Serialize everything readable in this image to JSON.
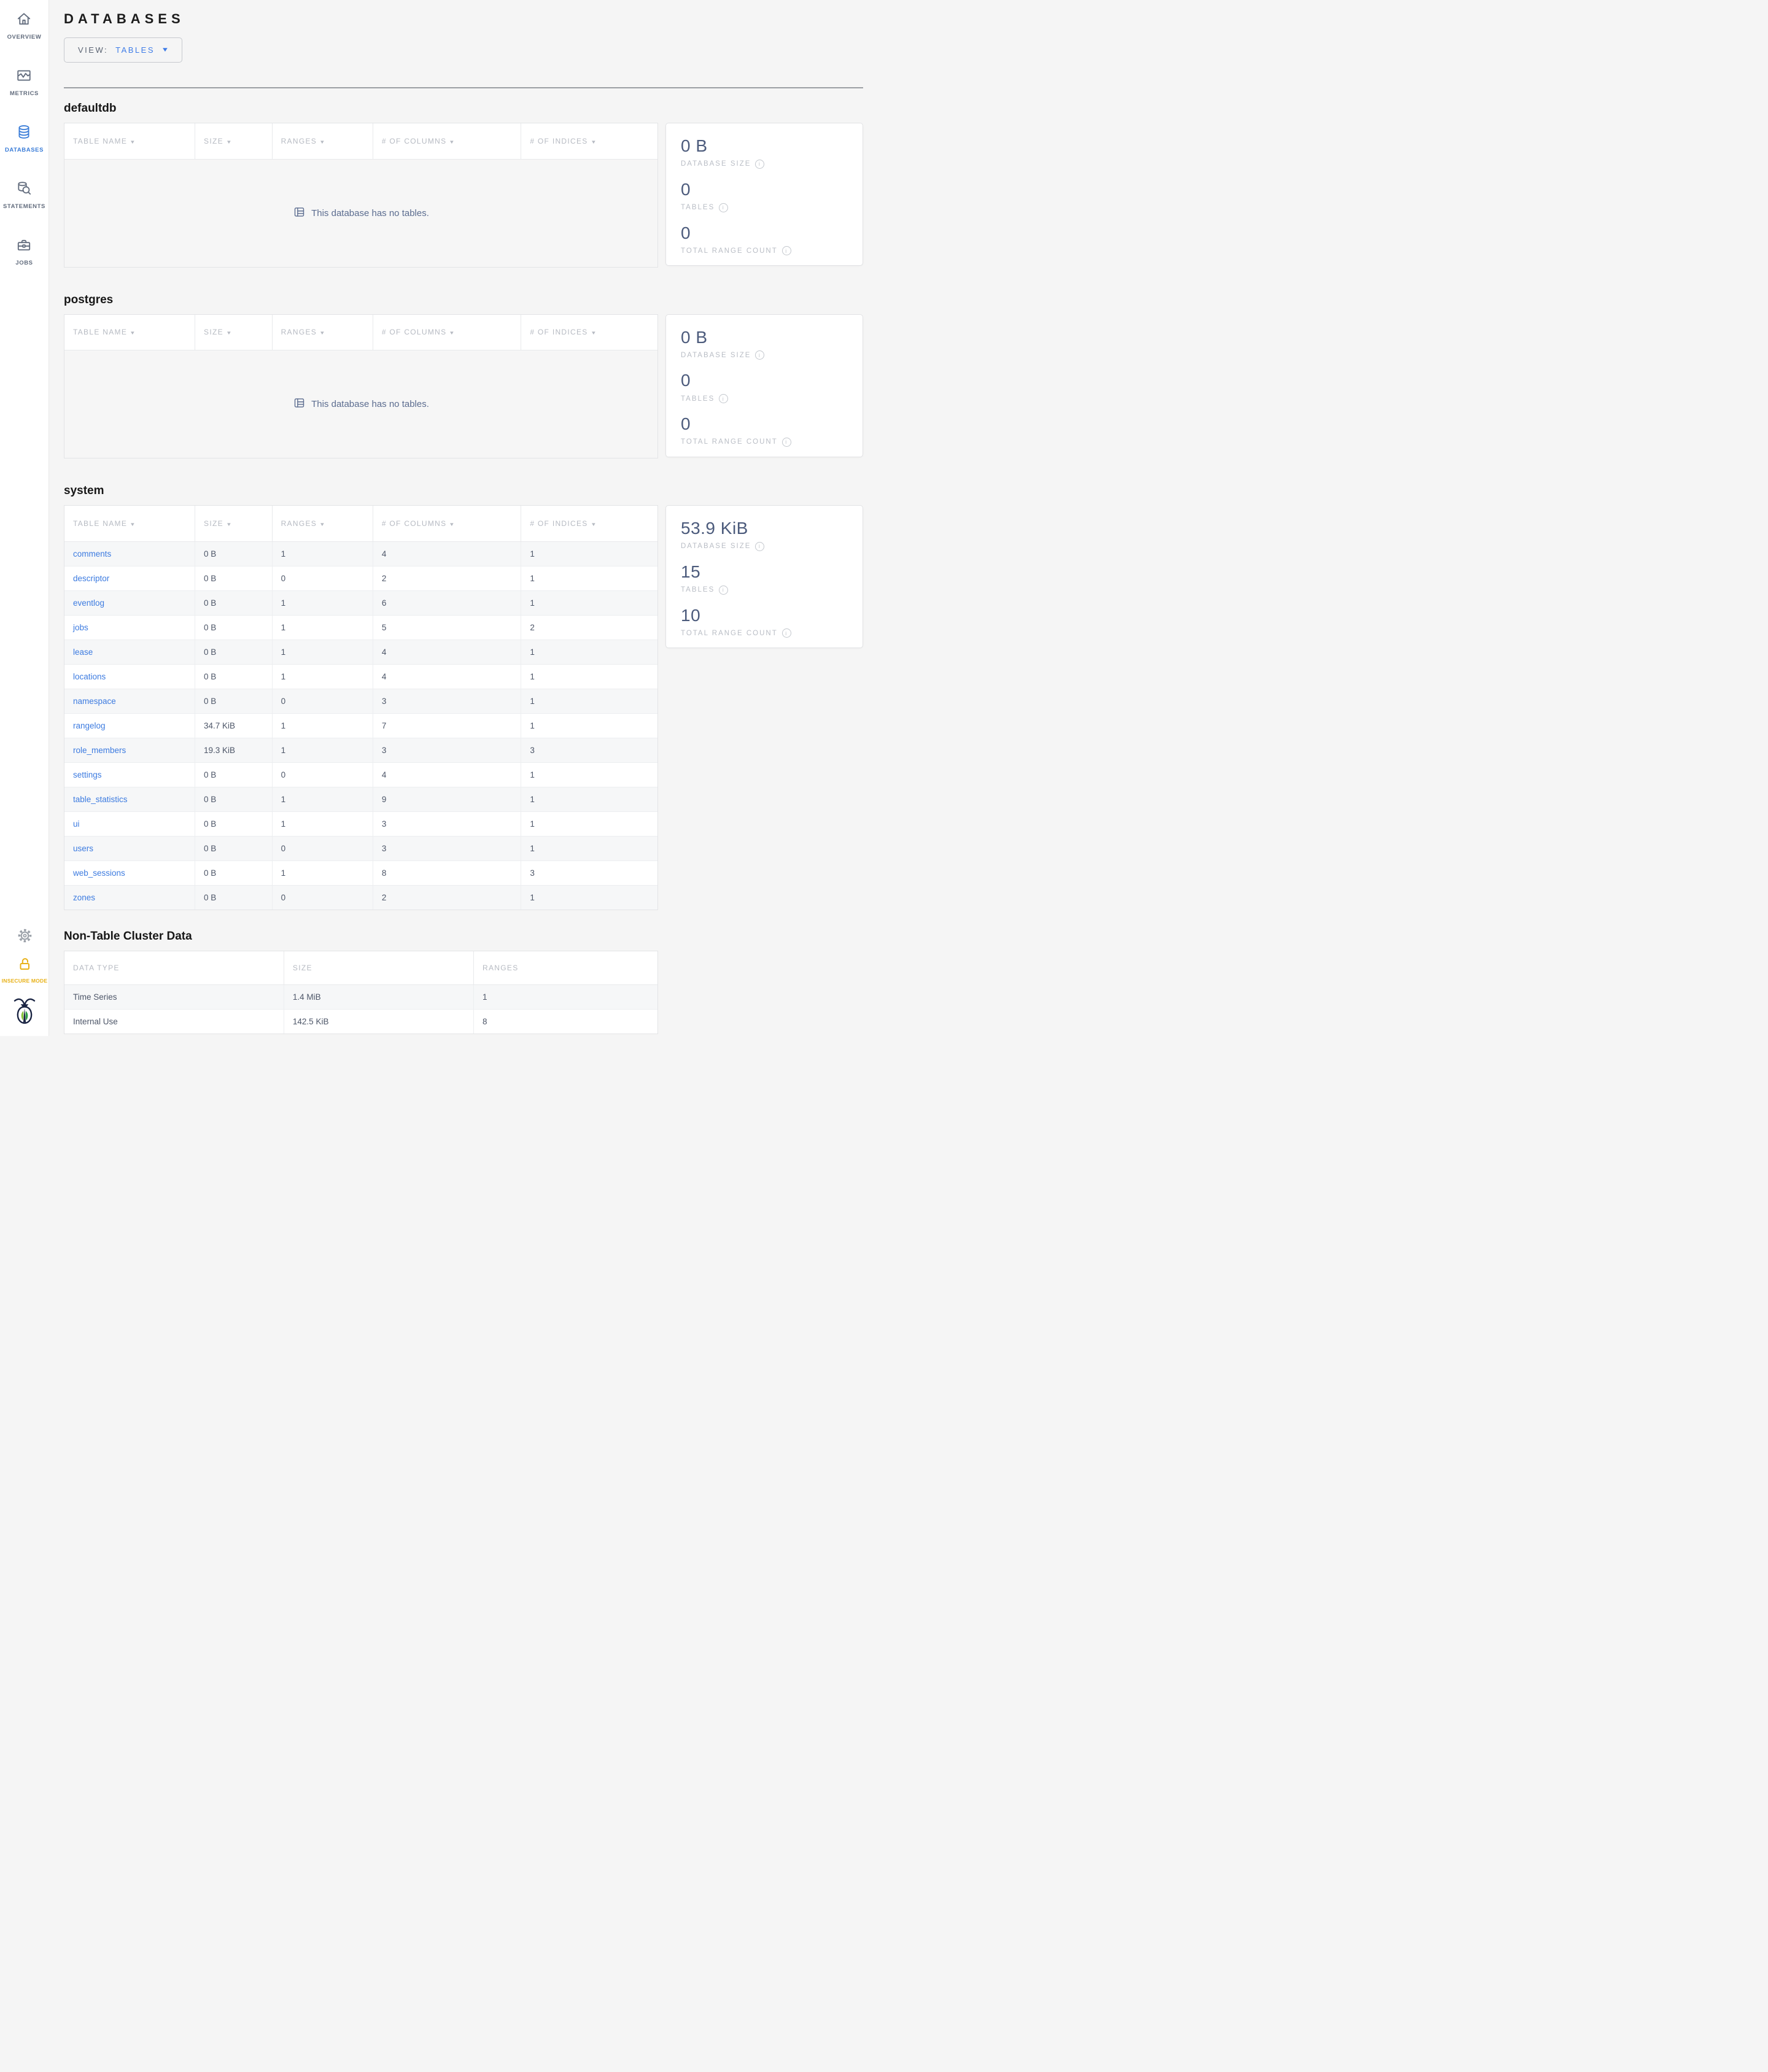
{
  "page": {
    "title": "DATABASES"
  },
  "view_control": {
    "label": "VIEW:",
    "value": "TABLES"
  },
  "icons": {
    "sort_arrow": "▼",
    "dropdown_caret": "▼",
    "info": "i"
  },
  "sidebar": {
    "items": [
      {
        "label": "OVERVIEW"
      },
      {
        "label": "METRICS"
      },
      {
        "label": "DATABASES"
      },
      {
        "label": "STATEMENTS"
      },
      {
        "label": "JOBS"
      }
    ],
    "insecure_label": "INSECURE MODE"
  },
  "db_table_headers": [
    "TABLE NAME",
    "SIZE",
    "RANGES",
    "# OF COLUMNS",
    "# OF INDICES"
  ],
  "stat_labels": {
    "size": "DATABASE SIZE",
    "tables": "TABLES",
    "ranges": "TOTAL RANGE COUNT"
  },
  "sections": {
    "defaultdb": {
      "name": "defaultdb",
      "empty_message": "This database has no tables.",
      "stats": {
        "size": "0 B",
        "tables": "0",
        "ranges": "0"
      }
    },
    "postgres": {
      "name": "postgres",
      "empty_message": "This database has no tables.",
      "stats": {
        "size": "0 B",
        "tables": "0",
        "ranges": "0"
      }
    },
    "system": {
      "name": "system",
      "stats": {
        "size": "53.9 KiB",
        "tables": "15",
        "ranges": "10"
      },
      "rows": [
        {
          "name": "comments",
          "size": "0 B",
          "ranges": "1",
          "columns": "4",
          "indices": "1"
        },
        {
          "name": "descriptor",
          "size": "0 B",
          "ranges": "0",
          "columns": "2",
          "indices": "1"
        },
        {
          "name": "eventlog",
          "size": "0 B",
          "ranges": "1",
          "columns": "6",
          "indices": "1"
        },
        {
          "name": "jobs",
          "size": "0 B",
          "ranges": "1",
          "columns": "5",
          "indices": "2"
        },
        {
          "name": "lease",
          "size": "0 B",
          "ranges": "1",
          "columns": "4",
          "indices": "1"
        },
        {
          "name": "locations",
          "size": "0 B",
          "ranges": "1",
          "columns": "4",
          "indices": "1"
        },
        {
          "name": "namespace",
          "size": "0 B",
          "ranges": "0",
          "columns": "3",
          "indices": "1"
        },
        {
          "name": "rangelog",
          "size": "34.7 KiB",
          "ranges": "1",
          "columns": "7",
          "indices": "1"
        },
        {
          "name": "role_members",
          "size": "19.3 KiB",
          "ranges": "1",
          "columns": "3",
          "indices": "3"
        },
        {
          "name": "settings",
          "size": "0 B",
          "ranges": "0",
          "columns": "4",
          "indices": "1"
        },
        {
          "name": "table_statistics",
          "size": "0 B",
          "ranges": "1",
          "columns": "9",
          "indices": "1"
        },
        {
          "name": "ui",
          "size": "0 B",
          "ranges": "1",
          "columns": "3",
          "indices": "1"
        },
        {
          "name": "users",
          "size": "0 B",
          "ranges": "0",
          "columns": "3",
          "indices": "1"
        },
        {
          "name": "web_sessions",
          "size": "0 B",
          "ranges": "1",
          "columns": "8",
          "indices": "3"
        },
        {
          "name": "zones",
          "size": "0 B",
          "ranges": "0",
          "columns": "2",
          "indices": "1"
        }
      ]
    }
  },
  "non_table": {
    "heading": "Non-Table Cluster Data",
    "headers": [
      "DATA TYPE",
      "SIZE",
      "RANGES"
    ],
    "rows": [
      {
        "type": "Time Series",
        "size": "1.4 MiB",
        "ranges": "1"
      },
      {
        "type": "Internal Use",
        "size": "142.5 KiB",
        "ranges": "8"
      }
    ]
  },
  "colors": {
    "accent_blue": "#3b7dd8",
    "link_blue": "#3c7be0",
    "insecure_gold": "#e8b117",
    "logo_navy": "#192342",
    "leaf_green_light": "#8bc53f",
    "leaf_green_dark": "#2f9e44"
  }
}
